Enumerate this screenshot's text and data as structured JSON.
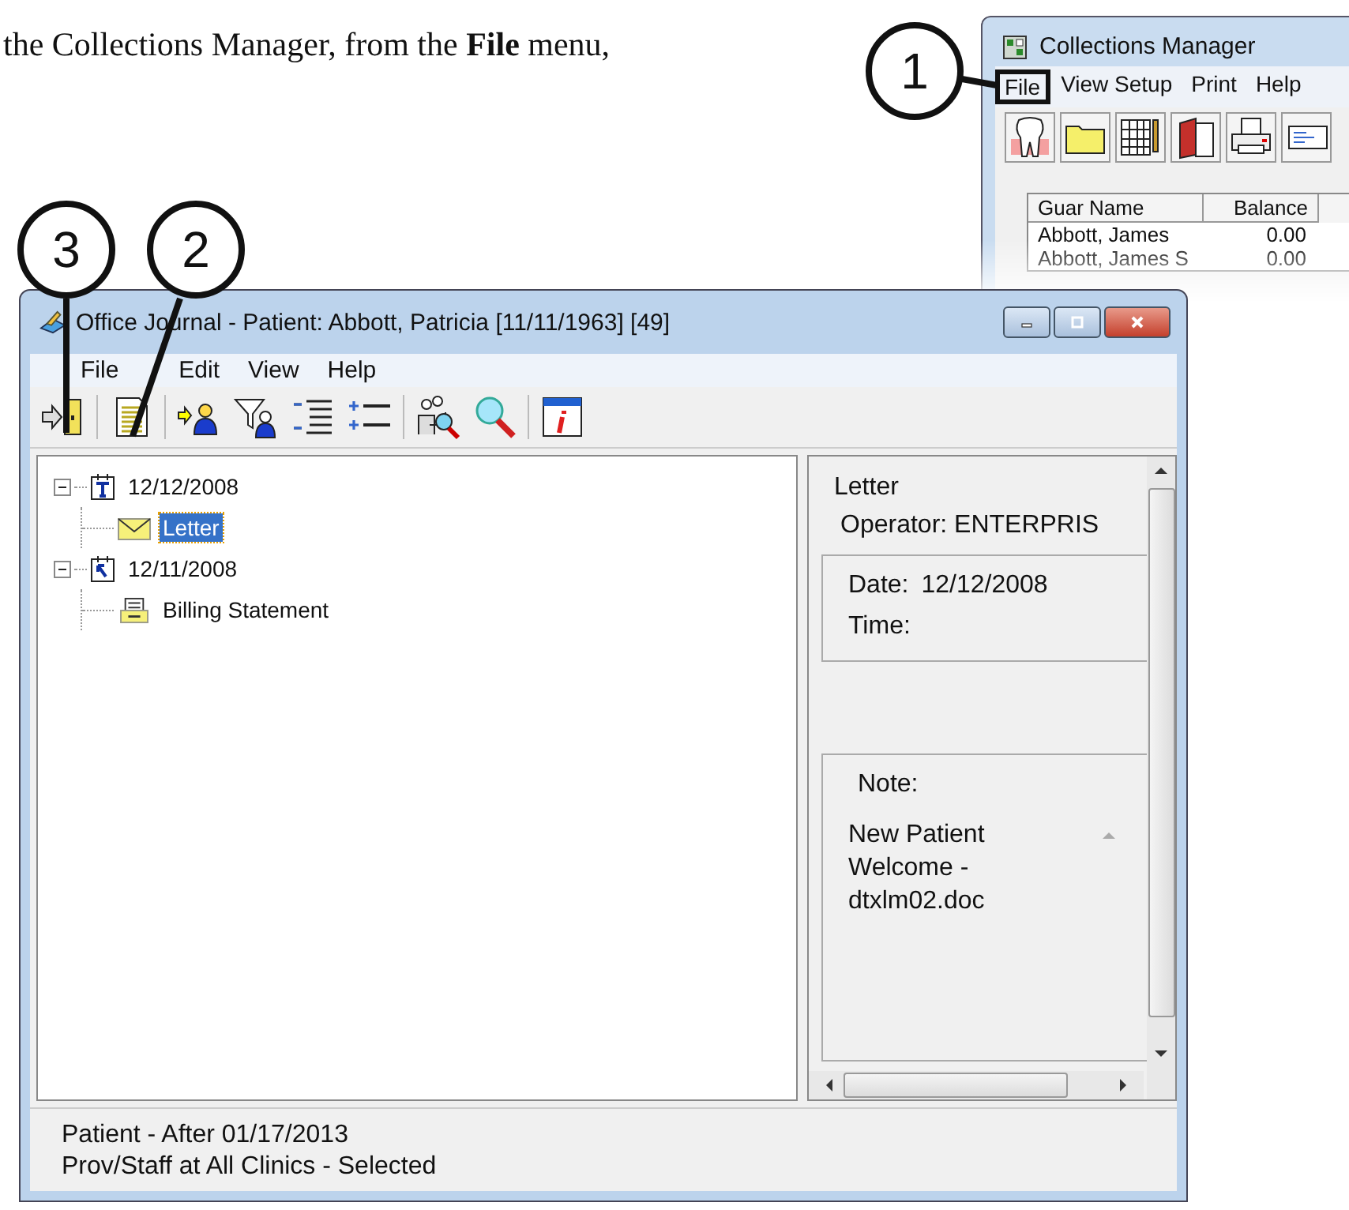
{
  "intro_text": "the Collections Manager, from the **File** menu,",
  "callouts": [
    {
      "number": "1"
    },
    {
      "number": "2"
    },
    {
      "number": "3"
    }
  ],
  "collections_window": {
    "title": "Collections Manager",
    "menu": [
      {
        "label": "File",
        "highlighted": true
      },
      {
        "label": "View Setup",
        "highlighted": false
      },
      {
        "label": "Print",
        "highlighted": false
      },
      {
        "label": "Help",
        "highlighted": false
      }
    ],
    "table": {
      "columns": [
        "Guar Name",
        "Balance"
      ],
      "rows": [
        [
          "Abbott, James",
          "0.00"
        ],
        [
          "Abbott, James S",
          "0.00"
        ]
      ]
    }
  },
  "journal_window": {
    "title": "Office Journal - Patient: Abbott, Patricia  [11/11/1963] [49]",
    "menu": [
      "File",
      "Edit",
      "View",
      "Help"
    ],
    "tree": [
      {
        "label": "12/12/2008",
        "kind": "task",
        "expanded": true,
        "children": [
          {
            "label": "Letter",
            "kind": "letter",
            "selected": true
          }
        ]
      },
      {
        "label": "12/11/2008",
        "kind": "event",
        "expanded": true,
        "children": [
          {
            "label": "Billing Statement",
            "kind": "statement",
            "selected": false
          }
        ]
      }
    ],
    "detail": {
      "title": "Letter",
      "operator": "Operator: ENTERPRIS",
      "date_label": "Date:",
      "date": "12/12/2008",
      "time_label": "Time:",
      "note_label": "Note:",
      "note": "New Patient Welcome - dtxlm02.doc"
    },
    "status_bar": [
      "Patient - After 01/17/2013",
      "Prov/Staff at All Clinics - Selected"
    ]
  }
}
